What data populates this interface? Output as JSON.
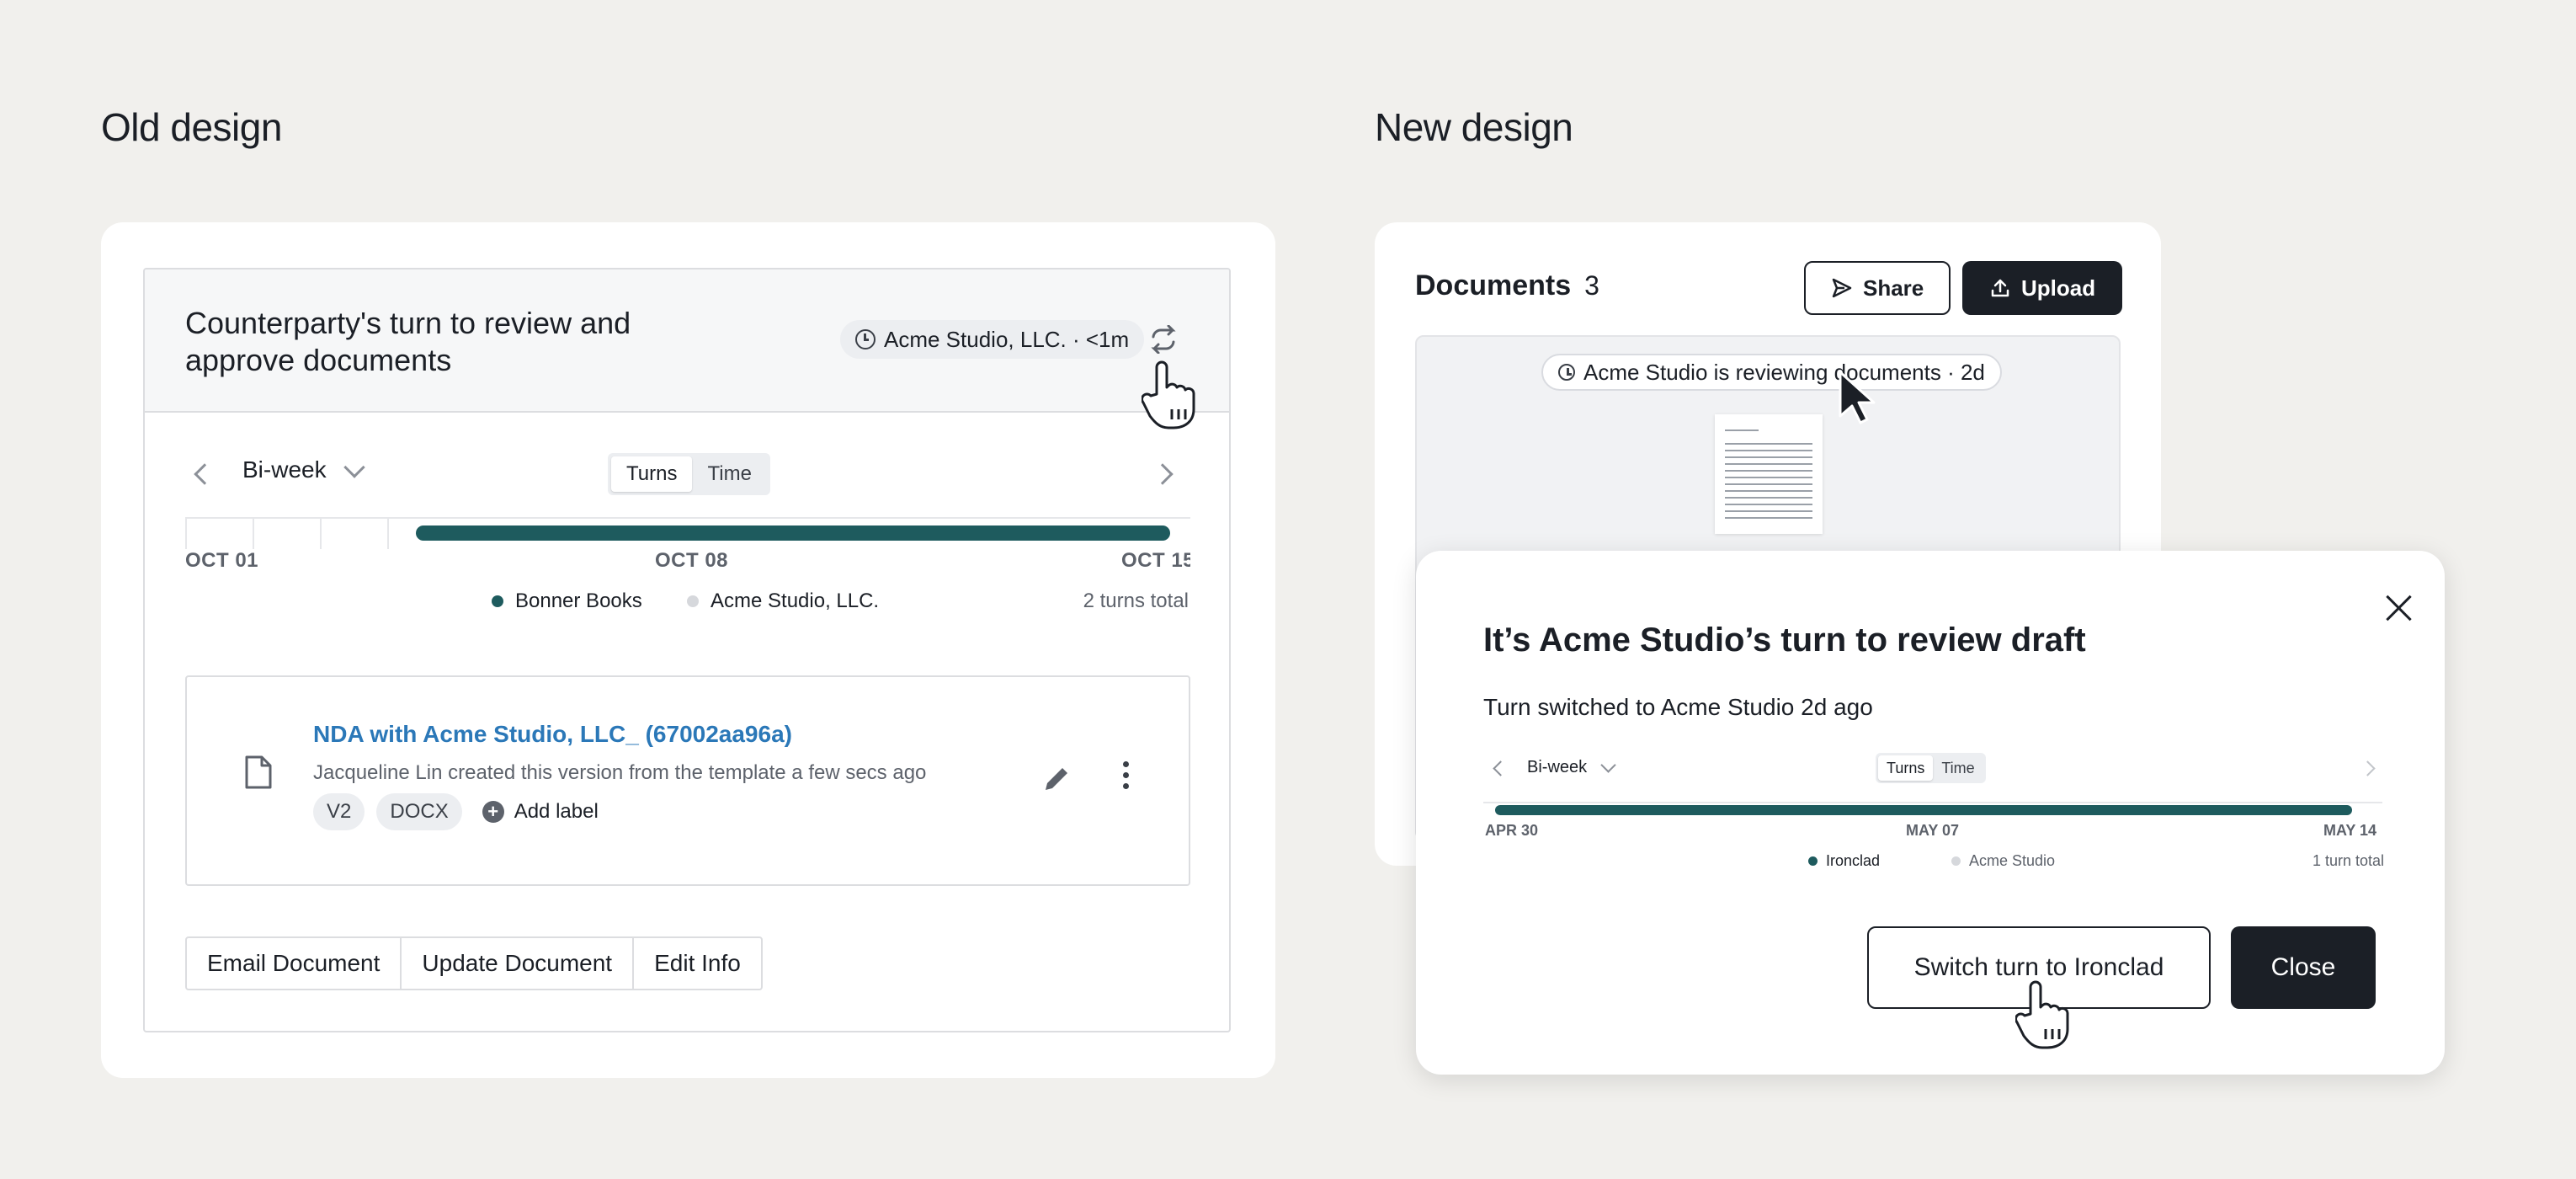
{
  "old": {
    "section_title": "Old design",
    "heading": "Counterparty's turn to review and approve documents",
    "status_pill": "Acme Studio, LLC. · <1m",
    "period": "Bi-week",
    "toggle": [
      "Turns",
      "Time"
    ],
    "ticks": [
      "OCT 01",
      "OCT 08",
      "OCT 15"
    ],
    "legend": [
      "Bonner Books",
      "Acme Studio, LLC."
    ],
    "turns_total": "2 turns total",
    "document": {
      "title": "NDA with Acme Studio, LLC_ (67002aa96a)",
      "subtitle": "Jacqueline Lin created this version from the template a few secs ago",
      "tags": [
        "V2",
        "DOCX"
      ],
      "add_label": "Add label"
    },
    "buttons": [
      "Email Document",
      "Update Document",
      "Edit Info"
    ]
  },
  "new": {
    "section_title": "New design",
    "documents_title": "Documents",
    "documents_count": "3",
    "share": "Share",
    "upload": "Upload",
    "status_pill": "Acme Studio is reviewing documents · 2d",
    "modal": {
      "title": "It’s Acme Studio’s turn to review draft",
      "subtitle": "Turn switched to Acme Studio 2d ago",
      "period": "Bi-week",
      "toggle": [
        "Turns",
        "Time"
      ],
      "ticks": [
        "APR 30",
        "MAY 07",
        "MAY 14"
      ],
      "legend": [
        "Ironclad",
        "Acme Studio"
      ],
      "turns_total": "1 turn total",
      "switch_button": "Switch turn to Ironclad",
      "close_button": "Close"
    }
  },
  "colors": {
    "track": "#1e5b5e",
    "accent_link": "#2b78b8",
    "dark": "#1b1f26"
  }
}
